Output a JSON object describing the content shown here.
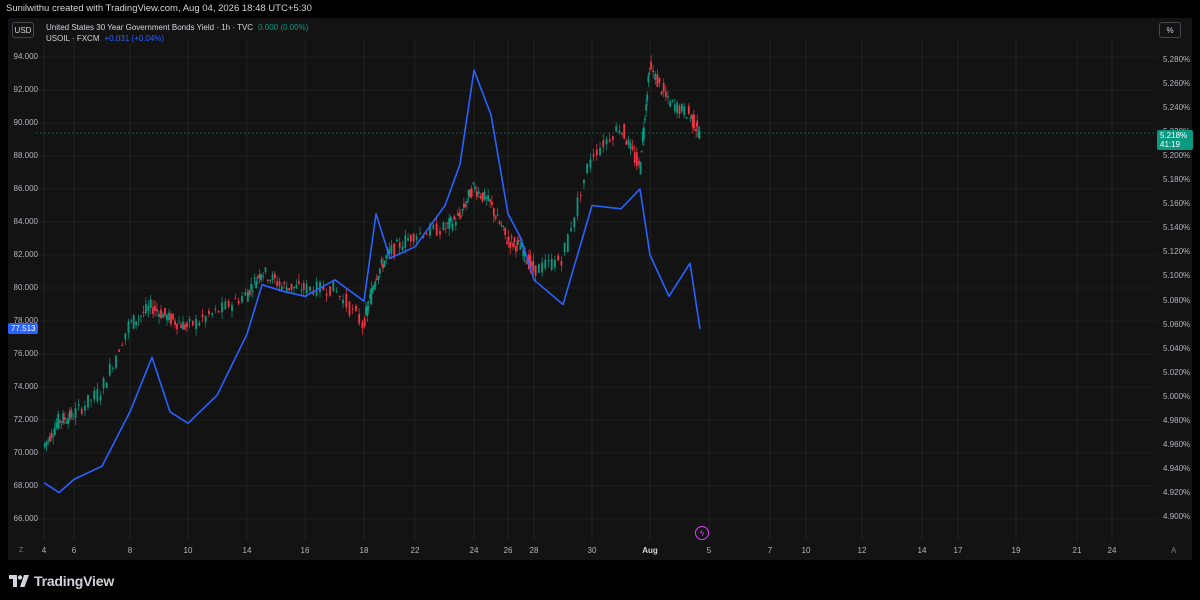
{
  "credit": "Sunilwithu created with TradingView.com, Aug 04, 2026 18:48 UTC+5:30",
  "left_unit": "USD",
  "right_unit": "%",
  "legend": {
    "main_name": "United States 30 Year Government Bonds Yield · 1h · TVC",
    "main_value": "0.000 (0.00%)",
    "overlay_name": "USOIL · FXCM",
    "overlay_value": "+0.031 (+0.04%)"
  },
  "current": {
    "yield_label": "5.218%",
    "countdown": "41:19",
    "oil_label": "77.513"
  },
  "brand": "TradingView",
  "colors": {
    "up": "#089981",
    "down": "#f23645",
    "oil_line": "#2962ff",
    "grid": "#2a2a2a"
  },
  "chart_data": {
    "type": "line",
    "left_axis": {
      "unit": "USD",
      "ticks": [
        "94.000",
        "92.000",
        "90.000",
        "88.000",
        "86.000",
        "84.000",
        "82.000",
        "80.000",
        "78.000",
        "76.000",
        "74.000",
        "72.000",
        "70.000",
        "68.000",
        "66.000"
      ],
      "range": [
        65.0,
        95.5
      ]
    },
    "right_axis": {
      "unit": "%",
      "ticks": [
        "5.280%",
        "5.260%",
        "5.240%",
        "5.220%",
        "5.200%",
        "5.180%",
        "5.160%",
        "5.140%",
        "5.120%",
        "5.100%",
        "5.080%",
        "5.060%",
        "5.040%",
        "5.020%",
        "5.000%",
        "4.980%",
        "4.960%",
        "4.940%",
        "4.920%",
        "4.900%"
      ],
      "range": [
        4.895,
        5.29
      ]
    },
    "x_axis": {
      "ticks": [
        "4",
        "6",
        "8",
        "10",
        "14",
        "16",
        "18",
        "22",
        "24",
        "26",
        "28",
        "30",
        "Aug",
        "5",
        "7",
        "10",
        "12",
        "14",
        "17",
        "19",
        "21",
        "24"
      ],
      "bold_tick": "Aug"
    },
    "series": [
      {
        "name": "USOIL · FXCM",
        "axis": "left",
        "style": "line",
        "x": [
          "Jul 4",
          "Jul 5",
          "Jul 6",
          "Jul 7",
          "Jul 8",
          "Jul 9",
          "Jul 10",
          "Jul 11",
          "Jul 12",
          "Jul 13",
          "Jul 14",
          "Jul 15",
          "Jul 16",
          "Jul 17",
          "Jul 18",
          "Jul 19",
          "Jul 20",
          "Jul 21",
          "Jul 22",
          "Jul 23",
          "Jul 24",
          "Jul 25",
          "Jul 26",
          "Jul 27",
          "Jul 28",
          "Jul 29",
          "Jul 30",
          "Jul 31",
          "Aug 1",
          "Aug 2",
          "Aug 3",
          "Aug 4",
          "Aug 4 18:48"
        ],
        "y": [
          68.2,
          67.6,
          68.4,
          69.2,
          72.5,
          75.8,
          72.5,
          71.8,
          73.5,
          77.2,
          80.2,
          79.8,
          79.5,
          80.5,
          79.2,
          84.5,
          81.8,
          82.5,
          85.0,
          87.5,
          93.2,
          90.5,
          84.5,
          83.0,
          80.5,
          79.0,
          85.0,
          84.8,
          86.0,
          82.0,
          79.5,
          81.5,
          77.513
        ]
      },
      {
        "name": "United States 30 Year Government Bonds Yield",
        "axis": "right",
        "style": "candles",
        "x": [
          "Jul 4",
          "Jul 5",
          "Jul 6",
          "Jul 7",
          "Jul 8",
          "Jul 9",
          "Jul 10",
          "Jul 11",
          "Jul 12",
          "Jul 13",
          "Jul 14",
          "Jul 15",
          "Jul 16",
          "Jul 17",
          "Jul 18",
          "Jul 19",
          "Jul 20",
          "Jul 21",
          "Jul 22",
          "Jul 23",
          "Jul 24",
          "Jul 25",
          "Jul 26",
          "Jul 27",
          "Jul 28",
          "Jul 29",
          "Jul 30",
          "Jul 31",
          "Aug 1",
          "Aug 2",
          "Aug 3",
          "Aug 4",
          "Aug 4 18:48"
        ],
        "y": [
          4.958,
          4.98,
          4.985,
          5.005,
          5.06,
          5.075,
          5.065,
          5.058,
          5.07,
          5.085,
          5.105,
          5.092,
          5.09,
          5.09,
          5.06,
          5.1,
          5.12,
          5.135,
          5.14,
          5.15,
          5.175,
          5.16,
          5.13,
          5.125,
          5.105,
          5.115,
          5.2,
          5.225,
          5.19,
          5.275,
          5.245,
          5.235,
          5.218
        ]
      }
    ]
  }
}
